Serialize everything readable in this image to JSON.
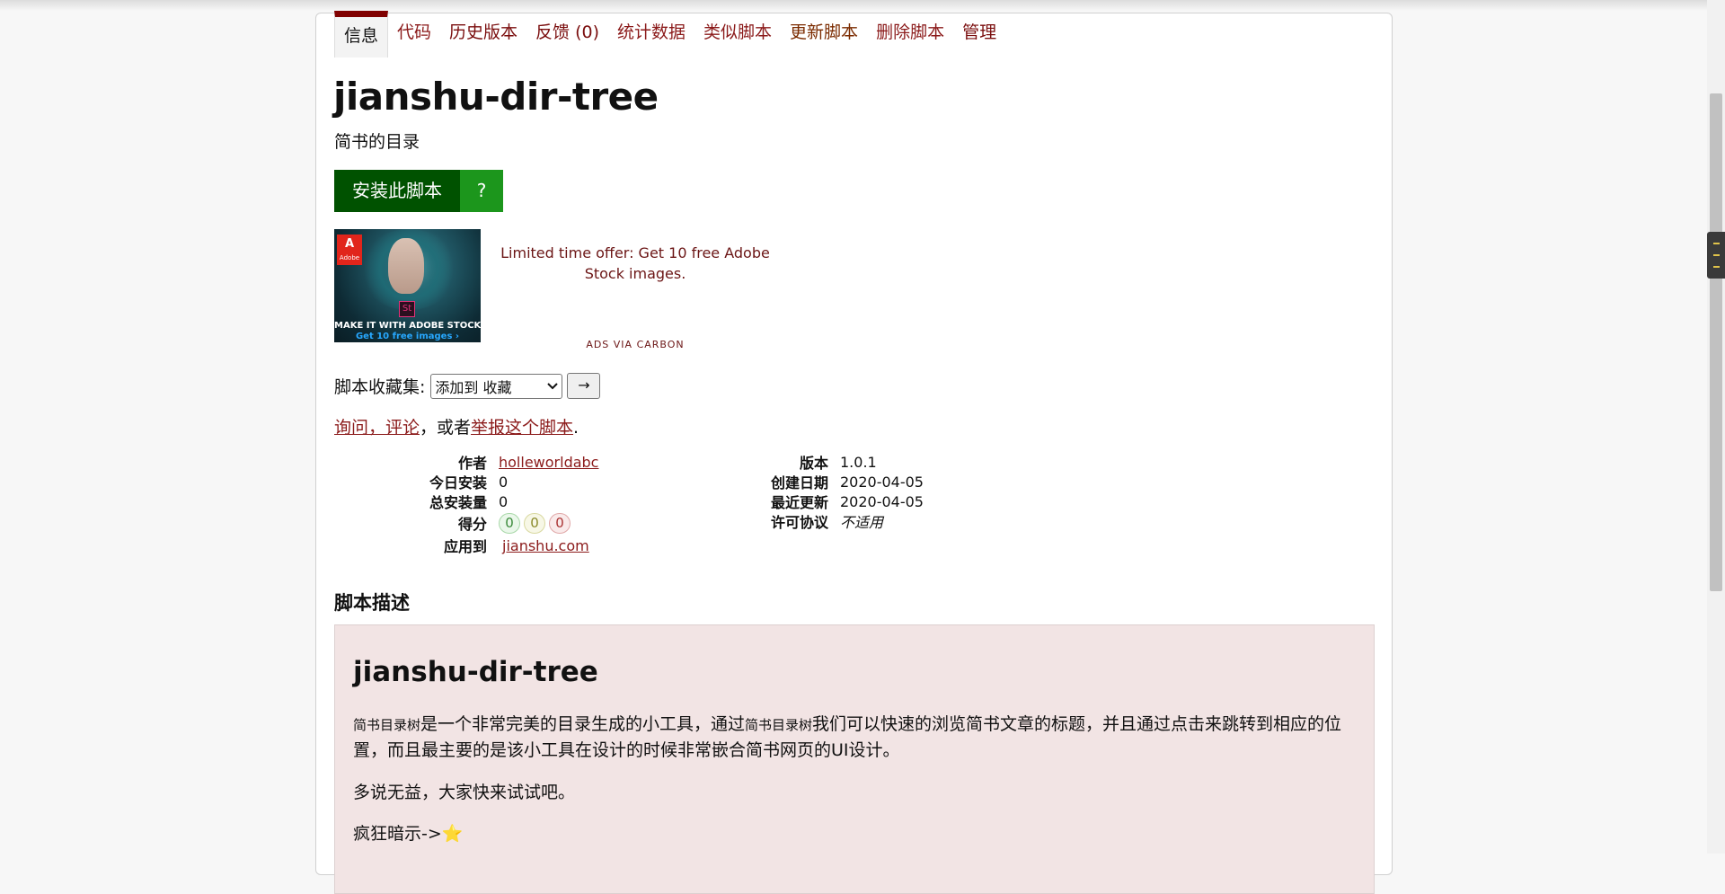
{
  "tabs": [
    {
      "label": "信息"
    },
    {
      "label": "代码"
    },
    {
      "label": "历史版本"
    },
    {
      "label": "反馈 (0)"
    },
    {
      "label": "统计数据"
    },
    {
      "label": "类似脚本"
    },
    {
      "label": "更新脚本"
    },
    {
      "label": "删除脚本"
    },
    {
      "label": "管理"
    }
  ],
  "script": {
    "title": "jianshu-dir-tree",
    "subtitle": "简书的目录"
  },
  "install": {
    "label": "安装此脚本",
    "help_label": "?"
  },
  "ad": {
    "logo_text": "A",
    "logo_brand": "Adobe",
    "product_badge": "St",
    "image_line1": "MAKE IT WITH ADOBE STOCK.",
    "image_line2": "Get 10 free images ›",
    "text": "Limited time offer: Get 10 free Adobe Stock images.",
    "via": "ADS VIA CARBON"
  },
  "collection": {
    "label": "脚本收藏集:",
    "selected": "添加到 收藏",
    "go_label": "→"
  },
  "feedback": {
    "link1": "询问，评论",
    "mid": "，或者",
    "link2": "举报这个脚本",
    "end": "."
  },
  "meta_left": {
    "author_k": "作者",
    "author_v": "holleworldabc",
    "daily_k": "今日安装",
    "daily_v": "0",
    "total_k": "总安装量",
    "total_v": "0",
    "score_k": "得分",
    "score_good": "0",
    "score_ok": "0",
    "score_bad": "0",
    "applies_k": "应用到",
    "applies_v": "jianshu.com"
  },
  "meta_right": {
    "version_k": "版本",
    "version_v": "1.0.1",
    "created_k": "创建日期",
    "created_v": "2020-04-05",
    "updated_k": "最近更新",
    "updated_v": "2020-04-05",
    "license_k": "许可协议",
    "license_v": "不适用"
  },
  "description": {
    "heading": "脚本描述",
    "title": "jianshu-dir-tree",
    "p1_small_a": "简书目录树",
    "p1_a": "是一个非常完美的目录生成的小工具，通过",
    "p1_small_b": "简书目录树",
    "p1_b": "我们可以快速的浏览简书文章的标题，并且通过点击来跳转到相应的位置，而且最主要的是该小工具在设计的时候非常嵌合简书网页的UI设计。",
    "p2": "多说无益，大家快来试试吧。",
    "p3": "疯狂暗示->",
    "p3_star": "⭐"
  },
  "colors": {
    "link": "#8b1a1a",
    "install_primary": "#005200",
    "install_help": "#1c961c",
    "active_tab_border": "#800000",
    "desc_bg": "#f2e4e4"
  }
}
